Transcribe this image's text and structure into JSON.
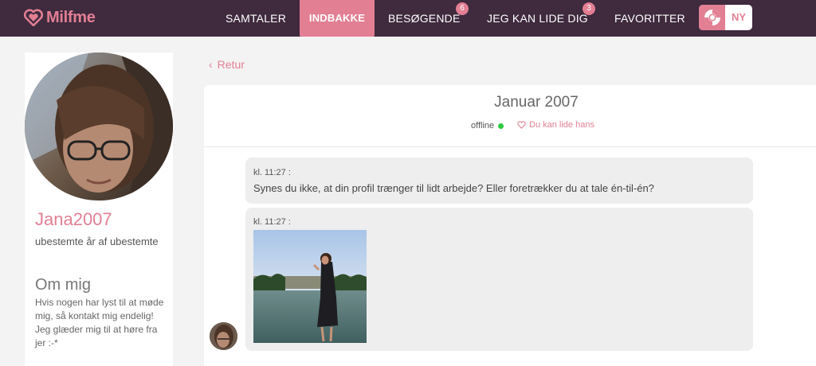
{
  "brand": {
    "name": "Milfme",
    "accent": "#e27f93",
    "navbar_bg": "#3f2a3e"
  },
  "nav": {
    "samtaler": "SAMTALER",
    "indbakke": "INDBAKKE",
    "besogende": "BESØGENDE",
    "besogende_badge": "6",
    "jeg_kan_lide_dig": "JEG KAN LIDE DIG",
    "jeg_kan_lide_dig_badge": "3",
    "favoritter": "FAVORITTER",
    "ny": "NY",
    "ny_icon": "lifebuoy-icon"
  },
  "profile": {
    "username": "Jana2007",
    "age_line": "ubestemte år af ubestemte",
    "about_title": "Om mig",
    "about_text": "Hvis nogen har lyst til at møde mig, så kontakt mig endelig! Jeg glæder mig til at høre fra jer :-*"
  },
  "conversation": {
    "back_label": "Retur",
    "title": "Januar 2007",
    "status": "offline",
    "like_label": "Du kan lide hans",
    "messages": [
      {
        "time": "kl. 11:27 :",
        "text": "Synes du ikke, at din profil trænger til lidt arbejde? Eller foretrækker du at tale én-til-én?"
      },
      {
        "time": "kl. 11:27 :",
        "image": "photo-woman-by-lake"
      }
    ]
  }
}
